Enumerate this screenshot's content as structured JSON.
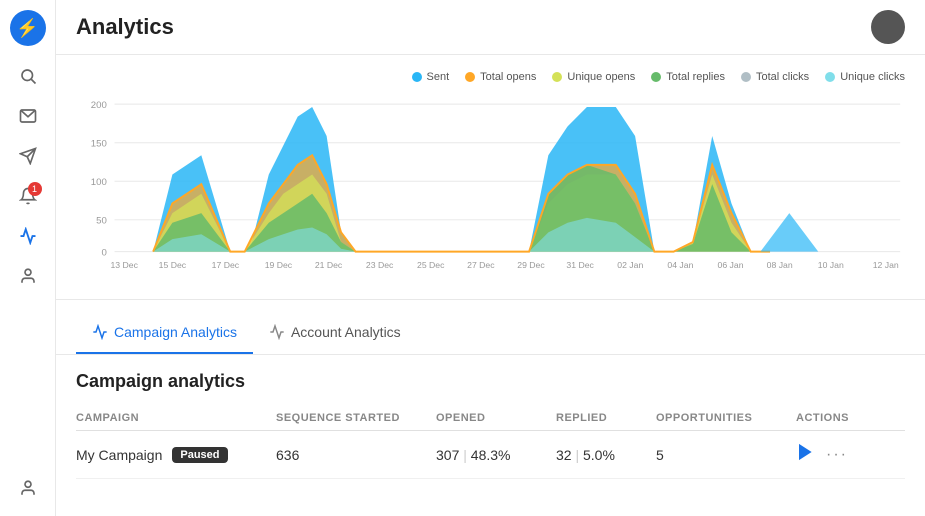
{
  "app": {
    "title": "Analytics"
  },
  "sidebar": {
    "logo_icon": "⚡",
    "items": [
      {
        "name": "search",
        "icon": "🔍",
        "active": false,
        "badge": null
      },
      {
        "name": "mail",
        "icon": "✉",
        "active": false,
        "badge": null
      },
      {
        "name": "send",
        "icon": "➤",
        "active": false,
        "badge": null
      },
      {
        "name": "notifications",
        "icon": "🔔",
        "active": false,
        "badge": "1"
      },
      {
        "name": "analytics",
        "icon": "〜",
        "active": true,
        "badge": null
      },
      {
        "name": "account",
        "icon": "👤",
        "active": false,
        "badge": null
      }
    ],
    "bottom_item": {
      "name": "user-bottom",
      "icon": "👤"
    }
  },
  "chart": {
    "legend": [
      {
        "key": "sent",
        "label": "Sent",
        "color": "#29b6f6"
      },
      {
        "key": "total_opens",
        "label": "Total opens",
        "color": "#ffa726"
      },
      {
        "key": "unique_opens",
        "label": "Unique opens",
        "color": "#d4e157"
      },
      {
        "key": "total_replies",
        "label": "Total replies",
        "color": "#66bb6a"
      },
      {
        "key": "total_clicks",
        "label": "Total clicks",
        "color": "#b0bec5"
      },
      {
        "key": "unique_clicks",
        "label": "Unique clicks",
        "color": "#80deea"
      }
    ],
    "x_labels": [
      "13 Dec",
      "15 Dec",
      "17 Dec",
      "19 Dec",
      "21 Dec",
      "23 Dec",
      "25 Dec",
      "27 Dec",
      "29 Dec",
      "31 Dec",
      "02 Jan",
      "04 Jan",
      "06 Jan",
      "08 Jan",
      "10 Jan",
      "12 Jan"
    ],
    "y_labels": [
      "0",
      "50",
      "100",
      "150",
      "200"
    ]
  },
  "tabs": [
    {
      "key": "campaign",
      "label": "Campaign Analytics",
      "active": true
    },
    {
      "key": "account",
      "label": "Account Analytics",
      "active": false
    }
  ],
  "campaign_analytics": {
    "section_title": "Campaign analytics",
    "table": {
      "headers": [
        "CAMPAIGN",
        "SEQUENCE STARTED",
        "OPENED",
        "REPLIED",
        "OPPORTUNITIES",
        "ACTIONS"
      ],
      "rows": [
        {
          "campaign": "My Campaign",
          "status": "Paused",
          "sequence_started": "636",
          "opened": "307",
          "opened_pct": "48.3%",
          "replied": "32",
          "replied_pct": "5.0%",
          "opportunities": "5"
        }
      ]
    }
  }
}
